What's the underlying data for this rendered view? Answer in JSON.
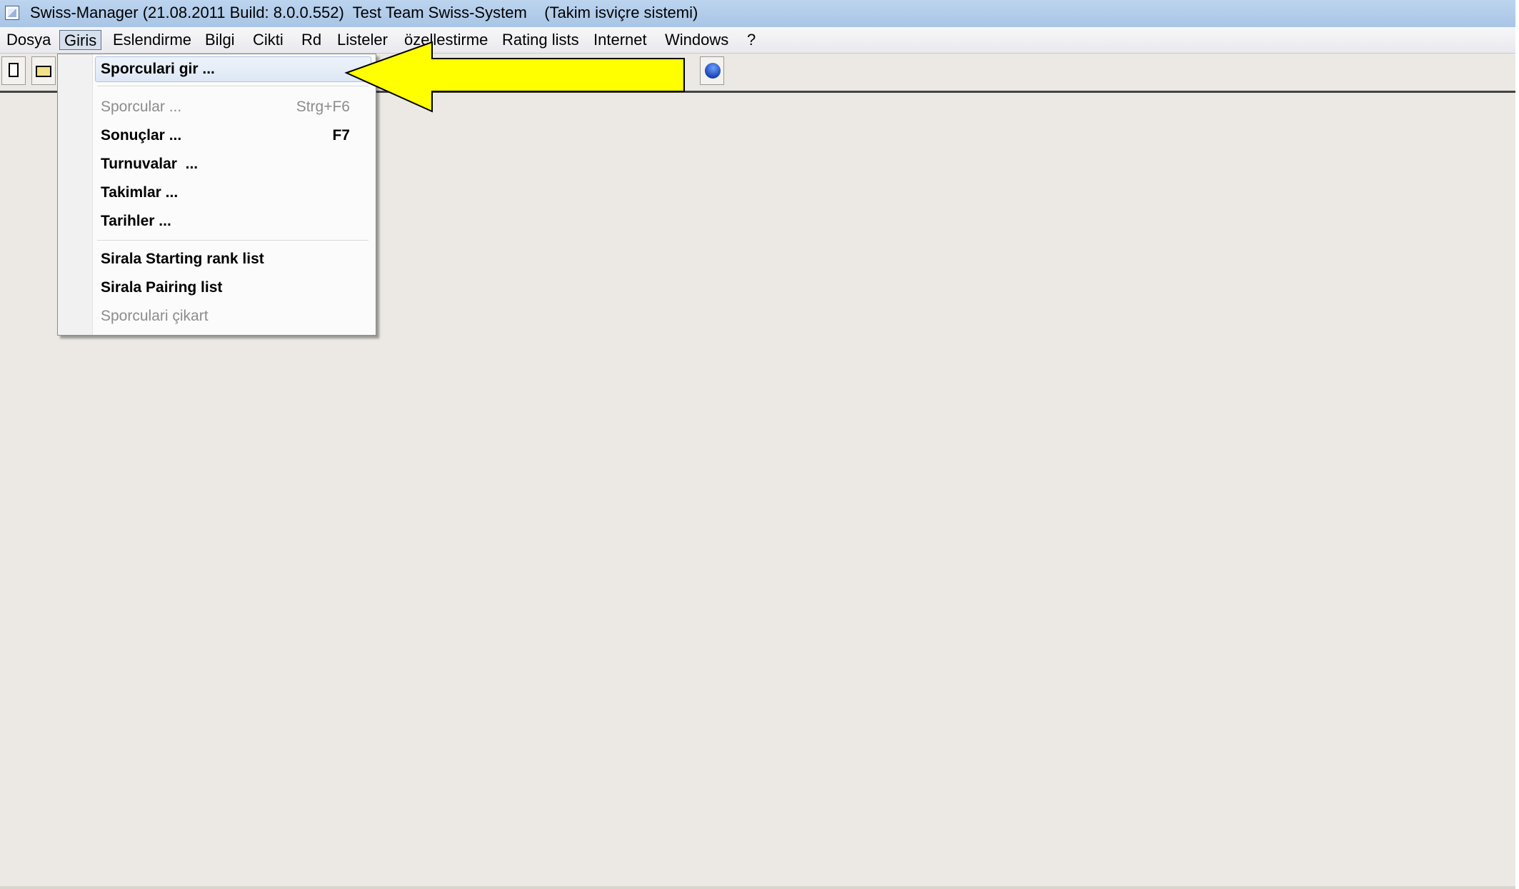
{
  "window": {
    "title": "Swiss-Manager (21.08.2011 Build: 8.0.0.552)  Test Team Swiss-System    (Takim isviçre sistemi)"
  },
  "menubar": {
    "items": [
      "Dosya",
      "Giris",
      "Eslendirme",
      "Bilgi",
      "Cikti",
      "Rd",
      "Listeler",
      "özellestirme",
      "Rating lists",
      "Internet",
      "Windows",
      "?"
    ],
    "active": "Giris"
  },
  "toolbar": {
    "icons": [
      "new-document-icon",
      "open-folder-icon",
      "globe-icon"
    ]
  },
  "dropdown": {
    "items": [
      {
        "label": "Sporculari gir ...",
        "shortcut": "",
        "enabled": true,
        "highlighted": true
      },
      {
        "label": "Sporcular ...",
        "shortcut": "Strg+F6",
        "enabled": false
      },
      {
        "label": "Sonuçlar ...",
        "shortcut": "F7",
        "enabled": true
      },
      {
        "label": "Turnuvalar  ...",
        "shortcut": "",
        "enabled": true
      },
      {
        "label": "Takimlar ...",
        "shortcut": "",
        "enabled": true
      },
      {
        "label": "Tarihler ...",
        "shortcut": "",
        "enabled": true
      },
      {
        "label": "Sirala Starting rank list",
        "shortcut": "",
        "enabled": true
      },
      {
        "label": "Sirala Pairing list",
        "shortcut": "",
        "enabled": true
      },
      {
        "label": "Sporculari çikart",
        "shortcut": "",
        "enabled": false
      }
    ]
  },
  "annotation": {
    "arrow_color": "#ffff00"
  }
}
